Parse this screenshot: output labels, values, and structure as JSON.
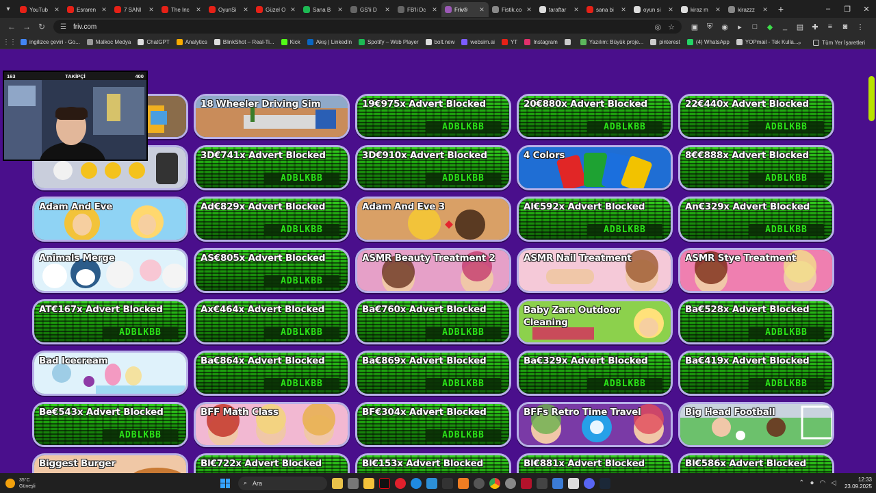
{
  "browser": {
    "tabs": [
      {
        "label": "YouTub",
        "color": "#e62117",
        "active": false
      },
      {
        "label": "Esraren",
        "color": "#e62117",
        "active": false
      },
      {
        "label": "7 SANI",
        "color": "#e62117",
        "active": false
      },
      {
        "label": "The Inc",
        "color": "#e62117",
        "active": false
      },
      {
        "label": "OyunSi",
        "color": "#e62117",
        "active": false
      },
      {
        "label": "Güzel O",
        "color": "#e62117",
        "active": false
      },
      {
        "label": "Sana B",
        "color": "#1db954",
        "active": false
      },
      {
        "label": "GS'li D",
        "color": "#666666",
        "active": false
      },
      {
        "label": "FB'li Dc",
        "color": "#666666",
        "active": false
      },
      {
        "label": "Friv®",
        "color": "#9b59b6",
        "active": true
      },
      {
        "label": "Fistik.co",
        "color": "#888888",
        "active": false
      },
      {
        "label": "taraftar",
        "color": "#dddddd",
        "active": false
      },
      {
        "label": "sana bi",
        "color": "#e62117",
        "active": false
      },
      {
        "label": "oyun si",
        "color": "#dddddd",
        "active": false
      },
      {
        "label": "kiraz m",
        "color": "#dddddd",
        "active": false
      },
      {
        "label": "kirazzz",
        "color": "#888888",
        "active": false
      }
    ],
    "url": "friv.com",
    "bookmarks": [
      {
        "label": "ingilizce çeviri - Go...",
        "color": "#4285f4"
      },
      {
        "label": "Malkoc Medya",
        "color": "#999999"
      },
      {
        "label": "ChatGPT",
        "color": "#dddddd"
      },
      {
        "label": "Analytics",
        "color": "#f9ab00"
      },
      {
        "label": "BlinkShot – Real-Ti...",
        "color": "#dddddd"
      },
      {
        "label": "Kick",
        "color": "#53fc18"
      },
      {
        "label": "Akış | LinkedIn",
        "color": "#0a66c2"
      },
      {
        "label": "Spotify – Web Player",
        "color": "#1db954"
      },
      {
        "label": "bolt.new",
        "color": "#dddddd"
      },
      {
        "label": "websim.ai",
        "color": "#7c5cff"
      },
      {
        "label": "YT",
        "color": "#e62117"
      },
      {
        "label": "Instagram",
        "color": "#e1306c"
      },
      {
        "label": "",
        "color": "#cccccc"
      },
      {
        "label": "Yazılım: Büyük proje...",
        "color": "#5cb85c"
      },
      {
        "label": "pinterest",
        "color": "#cccccc"
      },
      {
        "label": "(4) WhatsApp",
        "color": "#25d366"
      },
      {
        "label": "YOPmail - Tek Kulla...",
        "color": "#cccccc"
      }
    ],
    "all_bookmarks": "Tüm Yer İşaretleri"
  },
  "games": [
    {
      "title": "",
      "ad": false,
      "art": "truck"
    },
    {
      "title": "18 Wheeler Driving Sim",
      "ad": false,
      "art": "desert"
    },
    {
      "title": "19€975x Advert Blocked",
      "ad": true
    },
    {
      "title": "20€880x Advert Blocked",
      "ad": true
    },
    {
      "title": "22€440x Advert Blocked",
      "ad": true
    },
    {
      "title": "",
      "ad": false,
      "art": "coins"
    },
    {
      "title": "3D€741x Advert Blocked",
      "ad": true
    },
    {
      "title": "3D€910x Advert Blocked",
      "ad": true
    },
    {
      "title": "4 Colors",
      "ad": false,
      "art": "cards"
    },
    {
      "title": "8€€888x Advert Blocked",
      "ad": true
    },
    {
      "title": "Adam And Eve",
      "ad": false,
      "art": "adam"
    },
    {
      "title": "Ad€829x Advert Blocked",
      "ad": true
    },
    {
      "title": "Adam And Eve 3",
      "ad": false,
      "art": "adam3"
    },
    {
      "title": "Al€592x Advert Blocked",
      "ad": true
    },
    {
      "title": "An€329x Advert Blocked",
      "ad": true
    },
    {
      "title": "Animals Merge",
      "ad": false,
      "art": "animals"
    },
    {
      "title": "AS€805x Advert Blocked",
      "ad": true
    },
    {
      "title": "ASMR Beauty Treatment 2",
      "ad": false,
      "art": "beauty"
    },
    {
      "title": "ASMR Nail Treatment",
      "ad": false,
      "art": "nail"
    },
    {
      "title": "ASMR Stye Treatment",
      "ad": false,
      "art": "stye"
    },
    {
      "title": "AT€167x Advert Blocked",
      "ad": true
    },
    {
      "title": "Ax€464x Advert Blocked",
      "ad": true
    },
    {
      "title": "Ba€760x Advert Blocked",
      "ad": true
    },
    {
      "title": "Baby Zara Outdoor Cleaning",
      "ad": false,
      "art": "zara"
    },
    {
      "title": "Ba€528x Advert Blocked",
      "ad": true
    },
    {
      "title": "Bad Icecream",
      "ad": false,
      "art": "icecream"
    },
    {
      "title": "Ba€864x Advert Blocked",
      "ad": true
    },
    {
      "title": "Ba€869x Advert Blocked",
      "ad": true
    },
    {
      "title": "Ba€329x Advert Blocked",
      "ad": true
    },
    {
      "title": "Ba€419x Advert Blocked",
      "ad": true
    },
    {
      "title": "Be€543x Advert Blocked",
      "ad": true
    },
    {
      "title": "BFF Math Class",
      "ad": false,
      "art": "bff"
    },
    {
      "title": "BF€304x Advert Blocked",
      "ad": true
    },
    {
      "title": "BFFs Retro Time Travel",
      "ad": false,
      "art": "retro"
    },
    {
      "title": "Big Head Football",
      "ad": false,
      "art": "football"
    },
    {
      "title": "Biggest Burger",
      "ad": false,
      "art": "burger"
    },
    {
      "title": "Bl€722x Advert Blocked",
      "ad": true
    },
    {
      "title": "Bl€153x Advert Blocked",
      "ad": true
    },
    {
      "title": "Bl€881x Advert Blocked",
      "ad": true
    },
    {
      "title": "Bl€586x Advert Blocked",
      "ad": true
    }
  ],
  "adblock_stamp": "ADBLKBB",
  "webcam": {
    "left_count": "163",
    "label": "TAKİPÇİ",
    "right_count": "400"
  },
  "taskbar": {
    "weather_temp": "35°C",
    "weather_desc": "Güneşli",
    "search_placeholder": "Ara",
    "time": "12:33",
    "date": "23.09.2025"
  }
}
